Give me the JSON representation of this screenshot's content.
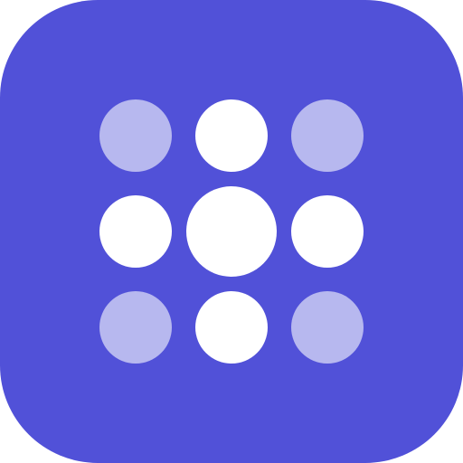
{
  "icon": {
    "name": "dot-grid-app-icon",
    "colors": {
      "background": "#5151d8",
      "dot_solid": "#ffffff",
      "dot_faded": "#b7b8ef"
    },
    "grid": [
      [
        "faded",
        "solid",
        "faded"
      ],
      [
        "solid",
        "solid-large",
        "solid"
      ],
      [
        "faded",
        "solid",
        "faded"
      ]
    ]
  }
}
